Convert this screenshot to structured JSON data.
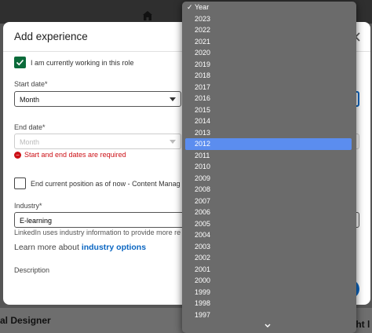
{
  "modal": {
    "title": "Add experience",
    "current_role_label": "I am currently working in this role",
    "start_date_label": "Start date*",
    "start_month_value": "Month",
    "end_date_label": "End date*",
    "end_month_placeholder": "Month",
    "error_message": "Start and end dates are required",
    "end_position_label": "End current position as of now - Content Manag",
    "industry_label": "Industry*",
    "industry_value": "E-learning",
    "industry_helper": "LinkedIn uses industry information to provide more re",
    "learn_more_prefix": "Learn more about ",
    "learn_more_link": "industry options",
    "description_label": "Description"
  },
  "background": {
    "bottom_left_text": "al Designer",
    "bottom_right_text": "ght l"
  },
  "year_dropdown": {
    "header": "Year",
    "header_check": "✓",
    "selected": "2012",
    "options": [
      "2023",
      "2022",
      "2021",
      "2020",
      "2019",
      "2018",
      "2017",
      "2016",
      "2015",
      "2014",
      "2013",
      "2012",
      "2011",
      "2010",
      "2009",
      "2008",
      "2007",
      "2006",
      "2005",
      "2004",
      "2003",
      "2002",
      "2001",
      "2000",
      "1999",
      "1998",
      "1997"
    ]
  },
  "colors": {
    "accent": "#0a66c2",
    "checkbox_green": "#0b6b3a",
    "error": "#cc1016",
    "dropdown_bg": "#6b6b6b",
    "dropdown_highlight": "#5b8def"
  }
}
